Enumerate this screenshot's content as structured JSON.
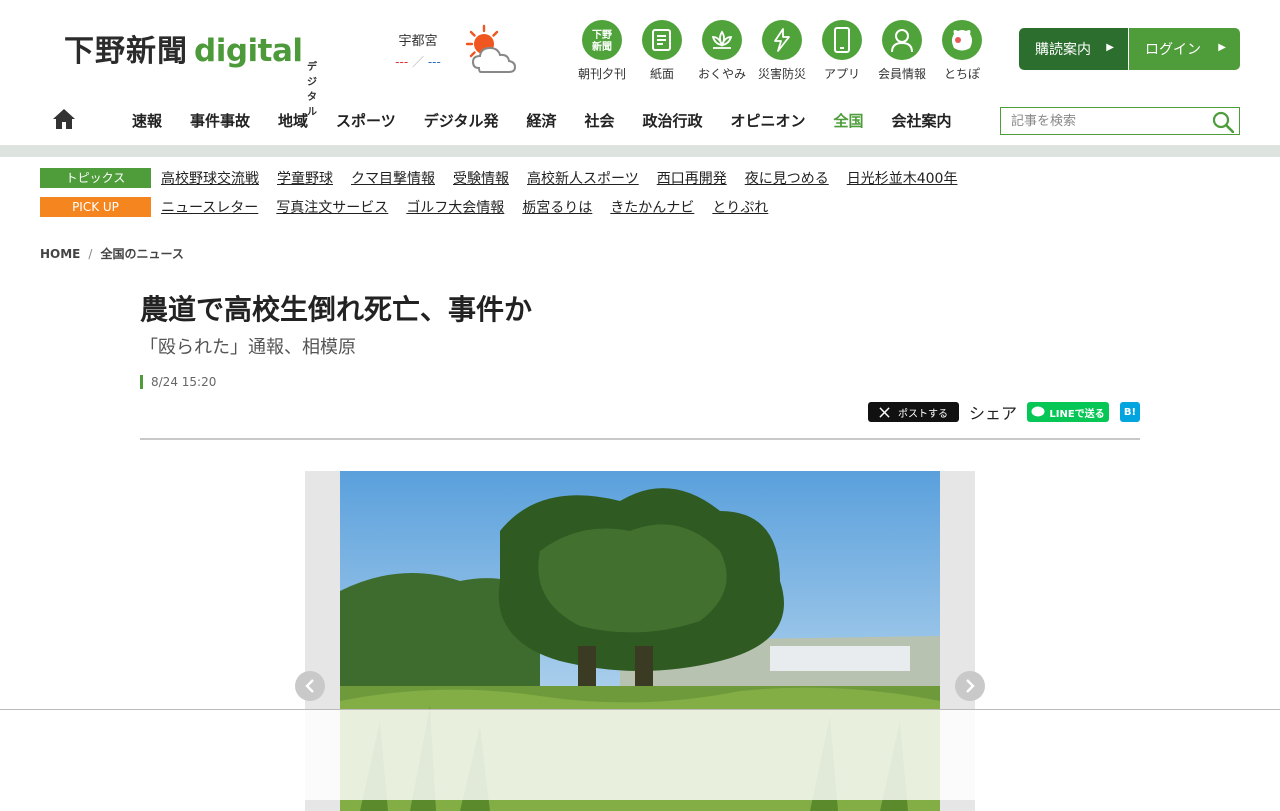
{
  "header": {
    "logo_kanji": "下野新聞",
    "logo_digital": "digital",
    "logo_sub": "デジタル",
    "weather": {
      "city": "宇都宮",
      "high": "---",
      "low": "---",
      "icon": "sun-cloud-icon"
    },
    "quick_nav": [
      {
        "label": "朝刊夕刊",
        "icon": "newspaper-logo-icon"
      },
      {
        "label": "紙面",
        "icon": "paper-icon"
      },
      {
        "label": "おくやみ",
        "icon": "lotus-icon"
      },
      {
        "label": "災害防災",
        "icon": "disaster-icon"
      },
      {
        "label": "アプリ",
        "icon": "smartphone-icon"
      },
      {
        "label": "会員情報",
        "icon": "member-icon"
      },
      {
        "label": "とちぽ",
        "icon": "mascot-icon"
      }
    ],
    "subscribe_label": "購読案内",
    "login_label": "ログイン"
  },
  "nav": {
    "items": [
      "速報",
      "事件事故",
      "地域",
      "スポーツ",
      "デジタル発",
      "経済",
      "社会",
      "政治行政",
      "オピニオン",
      "全国",
      "会社案内"
    ],
    "active": "全国",
    "search_placeholder": "記事を検索"
  },
  "topics": {
    "label": "トピックス",
    "links": [
      "高校野球交流戦",
      "学童野球",
      "クマ目撃情報",
      "受験情報",
      "高校新人スポーツ",
      "西口再開発",
      "夜に見つめる",
      "日光杉並木400年"
    ]
  },
  "pickup": {
    "label": "PICK UP",
    "links": [
      "ニュースレター",
      "写真注文サービス",
      "ゴルフ大会情報",
      "栃宮るりは",
      "きたかんナビ",
      "とりぷれ"
    ]
  },
  "breadcrumb": {
    "home": "HOME",
    "current": "全国のニュース"
  },
  "article": {
    "headline": "農道で高校生倒れ死亡、事件か",
    "subhead": "「殴られた」通報、相模原",
    "date": "8/24 15:20",
    "share": {
      "x_label": "ポストする",
      "share_text": "シェア",
      "line_label": "LINEで送る",
      "hatena_label": "B!"
    }
  },
  "colors": {
    "brand_green": "#4e9d3a",
    "dark_green": "#2c6e2e",
    "pickup_orange": "#f5861f"
  }
}
